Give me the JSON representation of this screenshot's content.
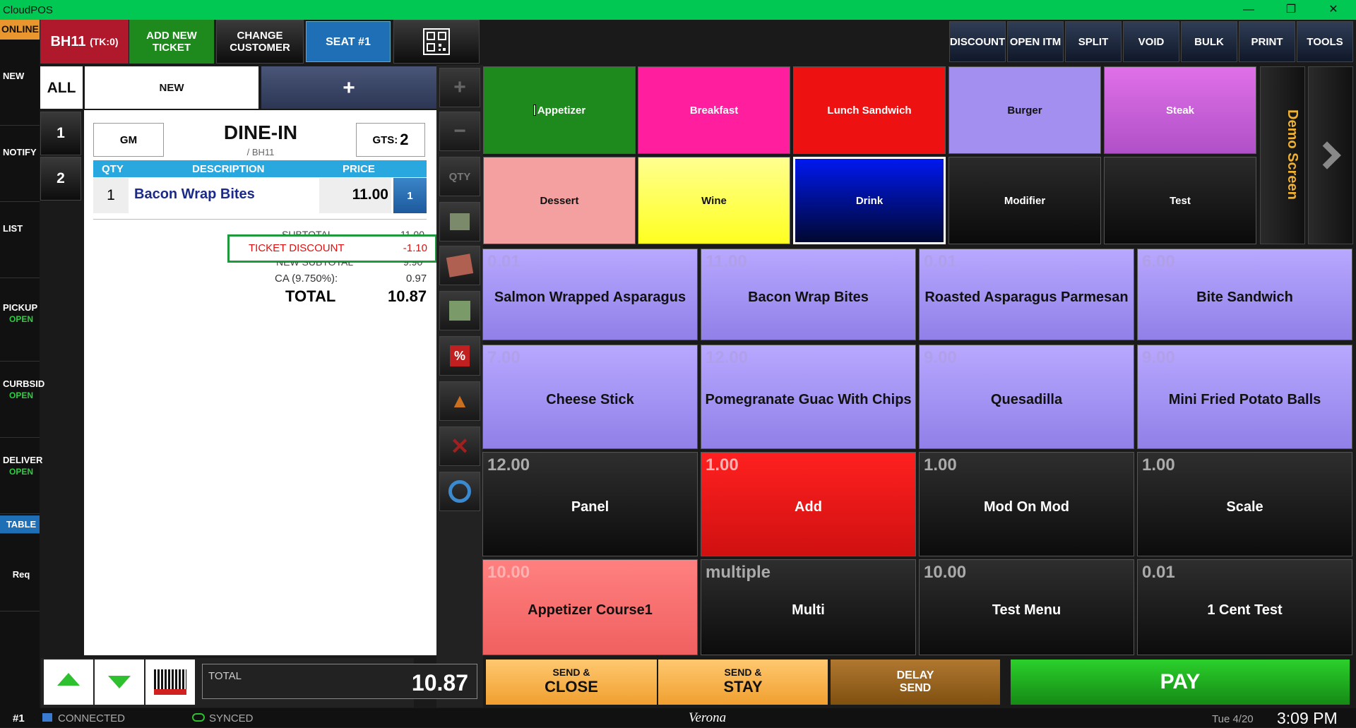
{
  "window": {
    "title": "CloudPOS",
    "minimize": "—",
    "restore": "❐",
    "close": "✕"
  },
  "status": {
    "online": "ONLINE"
  },
  "sidebar": [
    {
      "label": "NEW",
      "sub": ""
    },
    {
      "label": "NOTIFY",
      "sub": ""
    },
    {
      "label": "LIST",
      "sub": ""
    },
    {
      "label": "PICKUP",
      "sub": "OPEN"
    },
    {
      "label": "CURBSID",
      "sub": "OPEN"
    },
    {
      "label": "DELIVER",
      "sub": "OPEN"
    },
    {
      "label": "TABLE",
      "sub": ""
    },
    {
      "label": "Req",
      "sub": ""
    }
  ],
  "header": {
    "ticket_id": "BH11",
    "ticket_tk": "(TK:0)",
    "add_new_ticket": "ADD NEW TICKET",
    "change_customer": "CHANGE CUSTOMER",
    "seat": "SEAT #1",
    "qr_icon": "qr-code-icon"
  },
  "toolbar": [
    "DISCOUNT",
    "OPEN ITM",
    "SPLIT",
    "VOID",
    "BULK",
    "PRINT",
    "TOOLS"
  ],
  "tabs": {
    "all": "ALL",
    "new": "NEW",
    "plus": "+"
  },
  "seats": [
    "1",
    "2"
  ],
  "ticket": {
    "server": "GM",
    "order_type": "DINE-IN",
    "sub": "/ BH11",
    "gts_label": "GTS:",
    "gts": "2",
    "col_qty": "QTY",
    "col_desc": "DESCRIPTION",
    "col_price": "PRICE",
    "line": {
      "qty": "1",
      "desc": "Bacon Wrap Bites",
      "price": "11.00",
      "seat": "1"
    },
    "subtotal_label": "SUBTOTAL",
    "subtotal": "11.00",
    "discount_label": "TICKET DISCOUNT",
    "discount": "-1.10",
    "new_subtotal_label": "NEW SUBTOTAL",
    "new_subtotal": "9.90",
    "tax_label": "CA (9.750%):",
    "tax": "0.97",
    "total_label": "TOTAL",
    "total": "10.87"
  },
  "tools": [
    "plus-icon",
    "minus-icon",
    "QTY",
    "gift-icon",
    "memo-icon",
    "money-note-icon",
    "percent-off-icon",
    "fire-icon",
    "x-icon",
    "refresh-icon"
  ],
  "categories": [
    {
      "label": "Appetizer",
      "bg": "#1e8a1e"
    },
    {
      "label": "Breakfast",
      "bg": "#ff1e9e"
    },
    {
      "label": "Lunch Sandwich",
      "bg": "#ee1111"
    },
    {
      "label": "Burger",
      "bg": "#a38ff0"
    },
    {
      "label": "Steak",
      "bg": "#d060d8"
    },
    {
      "label": "Dessert",
      "bg": "#f4a0a0"
    },
    {
      "label": "Wine",
      "bg": "#ffff30"
    },
    {
      "label": "Drink",
      "bg": "#0010e0"
    },
    {
      "label": "Modifier",
      "bg": "#1a1a1a"
    },
    {
      "label": "Test",
      "bg": "#1a1a1a"
    }
  ],
  "demo_screen": "Demo Screen",
  "items": [
    {
      "price": "0.01",
      "name": "Salmon Wrapped Asparagus",
      "style": "purple"
    },
    {
      "price": "11.00",
      "name": "Bacon Wrap Bites",
      "style": "purple"
    },
    {
      "price": "0.01",
      "name": "Roasted Asparagus Parmesan",
      "style": "purple"
    },
    {
      "price": "6.00",
      "name": "Bite Sandwich",
      "style": "purple"
    },
    {
      "price": "7.00",
      "name": "Cheese Stick",
      "style": "purple"
    },
    {
      "price": "12.00",
      "name": "Pomegranate Guac With Chips",
      "style": "purple"
    },
    {
      "price": "9.00",
      "name": "Quesadilla",
      "style": "purple"
    },
    {
      "price": "9.00",
      "name": "Mini Fried Potato Balls",
      "style": "purple"
    },
    {
      "price": "12.00",
      "name": "Panel",
      "style": "dark"
    },
    {
      "price": "1.00",
      "name": "Add",
      "style": "red"
    },
    {
      "price": "1.00",
      "name": "Mod On Mod",
      "style": "dark"
    },
    {
      "price": "1.00",
      "name": "Scale",
      "style": "dark"
    },
    {
      "price": "10.00",
      "name": "Appetizer Course1",
      "style": "salmon"
    },
    {
      "price": "multiple",
      "name": "Multi",
      "style": "dark"
    },
    {
      "price": "10.00",
      "name": "Test Menu",
      "style": "dark"
    },
    {
      "price": "0.01",
      "name": "1 Cent Test",
      "style": "dark"
    }
  ],
  "footer": {
    "total_label": "TOTAL",
    "total": "10.87",
    "send_close_top": "SEND &",
    "send_close_bottom": "CLOSE",
    "send_stay_top": "SEND &",
    "send_stay_bottom": "STAY",
    "delay_top": "DELAY",
    "delay_bottom": "SEND",
    "pay": "PAY"
  },
  "bottombar": {
    "station": "#1",
    "connected": "CONNECTED",
    "synced": "SYNCED",
    "store": "Verona",
    "date": "Tue 4/20",
    "time": "3:09 PM"
  }
}
